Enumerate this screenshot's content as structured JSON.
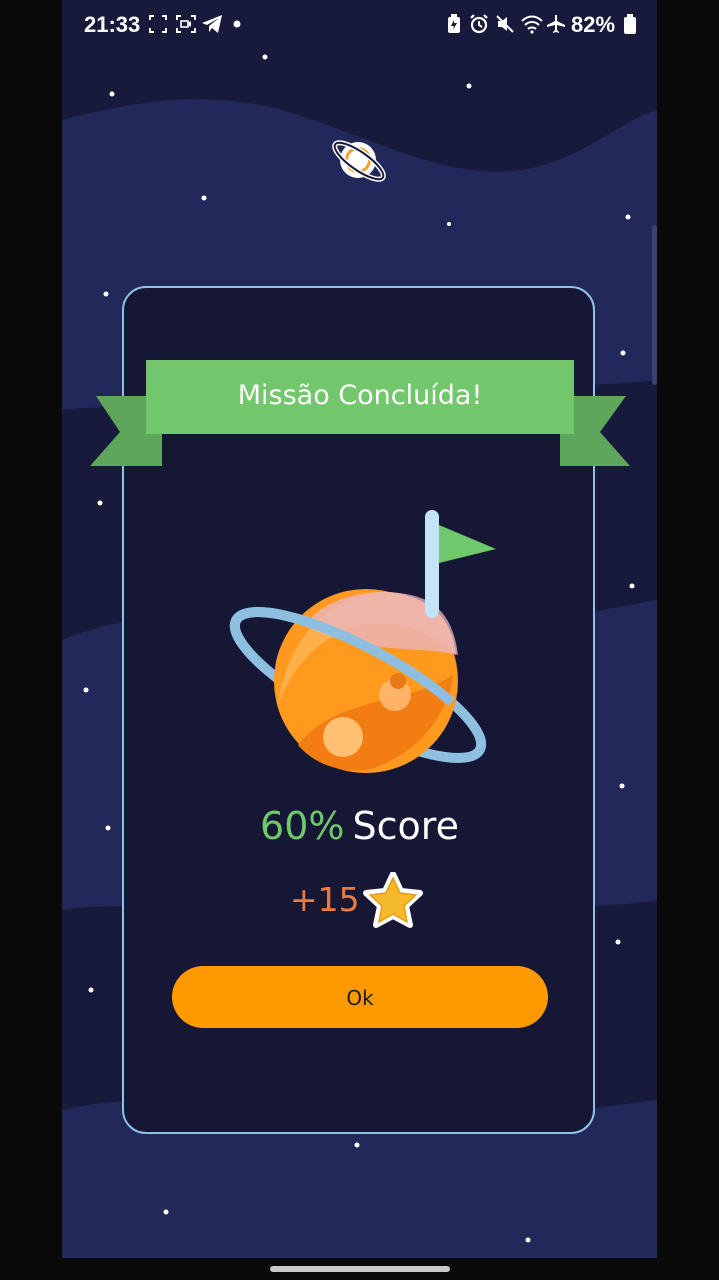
{
  "status_bar": {
    "time": "21:33",
    "battery_percent": "82%",
    "left_icons": [
      "screenshot-icon",
      "screen-record-icon",
      "telegram-icon",
      "dot-icon"
    ],
    "right_icons": [
      "battery-saver-icon",
      "alarm-icon",
      "mute-icon",
      "wifi-icon",
      "airplane-icon",
      "battery-icon"
    ]
  },
  "header": {
    "logo_icon": "planet-logo-icon"
  },
  "dialog": {
    "title": "Missão Concluída!",
    "illustration": "planet-flag-icon",
    "score_value": "60%",
    "score_label": "Score",
    "reward_points": "+15",
    "reward_icon": "star-icon",
    "ok_label": "Ok"
  },
  "colors": {
    "background": "#171a3a",
    "wave": "#22295a",
    "ribbon": "#72c66c",
    "ribbon_tail": "#5ea65b",
    "card_border": "#8fc3e6",
    "score_green": "#6fc86a",
    "reward_orange": "#f07a3c",
    "button": "#ff9900"
  }
}
